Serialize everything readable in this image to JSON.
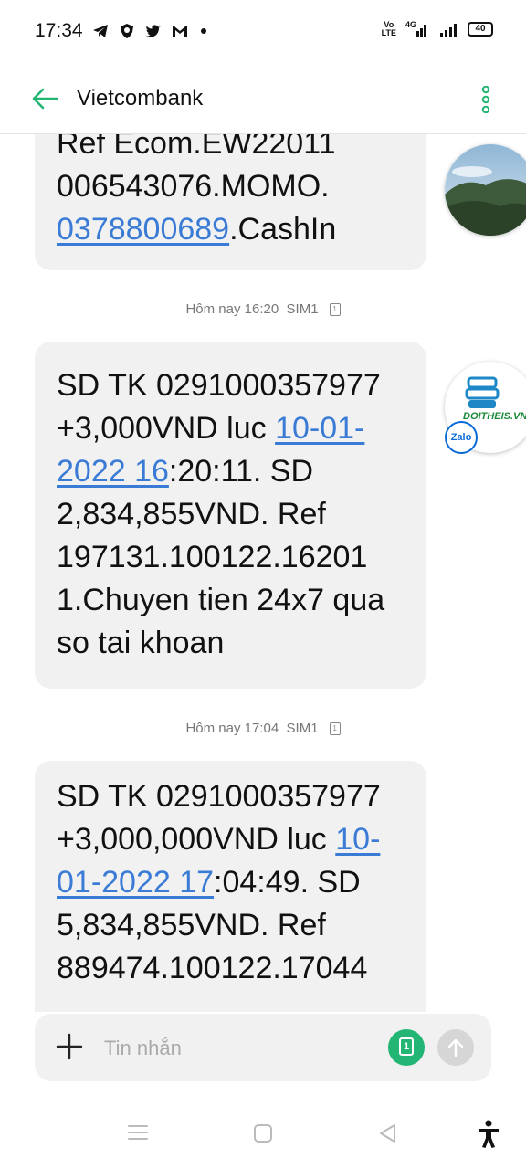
{
  "status_bar": {
    "time": "17:34",
    "volte_top": "Vo",
    "volte_bottom": "LTE",
    "network": "4G",
    "battery": "40"
  },
  "header": {
    "title": "Vietcombank",
    "accent_color": "#22b573"
  },
  "messages": [
    {
      "segments": [
        {
          "text": "Ref Ecom.EW22011 006543076.MOMO.",
          "link": false
        },
        {
          "text": "0378800689",
          "link": true
        },
        {
          "text": ".CashIn",
          "link": false
        }
      ]
    },
    {
      "timestamp": "Hôm nay 16:20",
      "sim": "SIM1",
      "sim_badge": "1",
      "segments": [
        {
          "text": "SD TK 0291000357977 +3,000VND luc ",
          "link": false
        },
        {
          "text": "10-01-2022 16",
          "link": true
        },
        {
          "text": ":20:11. SD 2,834,855VND. Ref 197131.100122.16201 1.Chuyen tien 24x7 qua so tai khoan",
          "link": false
        }
      ]
    },
    {
      "timestamp": "Hôm nay 17:04",
      "sim": "SIM1",
      "sim_badge": "1",
      "segments": [
        {
          "text": "SD TK 0291000357977 +3,000,000VND luc ",
          "link": false
        },
        {
          "text": "10-01-2022 17",
          "link": true
        },
        {
          "text": ":04:49. SD 5,834,855VND. Ref 889474.100122.17044",
          "link": false
        }
      ]
    }
  ],
  "chat_heads": {
    "logo_text": "DOITHEIS.VN",
    "zalo_label": "Zalo"
  },
  "compose": {
    "placeholder": "Tin nhắn",
    "sim_badge": "1"
  },
  "link_color": "#3a7bd5"
}
